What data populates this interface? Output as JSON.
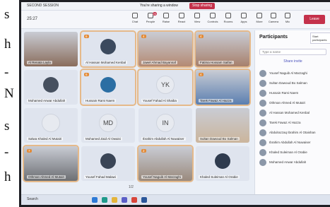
{
  "left_margin_text": [
    "s",
    "h",
    "-",
    "N",
    "s",
    "-",
    "h"
  ],
  "window": {
    "title": "SECOND SESSION",
    "sharing_text": "You're sharing a window",
    "stop_sharing_label": "Stop sharing",
    "timer": "25:27"
  },
  "toolbar": {
    "items": [
      {
        "label": "Chat",
        "icon": "chat-icon"
      },
      {
        "label": "People",
        "icon": "people-icon",
        "badge": "20"
      },
      {
        "label": "Raise",
        "icon": "raise-hand-icon"
      },
      {
        "label": "React",
        "icon": "react-icon"
      },
      {
        "label": "View",
        "icon": "view-icon"
      },
      {
        "label": "Controls",
        "icon": "controls-icon"
      },
      {
        "label": "Rooms",
        "icon": "rooms-icon"
      },
      {
        "label": "Apps",
        "icon": "apps-icon"
      },
      {
        "label": "More",
        "icon": "more-icon"
      },
      {
        "label": "Camera",
        "icon": "camera-icon"
      },
      {
        "label": "Mic",
        "icon": "mic-icon"
      },
      {
        "label": "Stop sharing",
        "icon": "share-icon"
      }
    ],
    "leave_label": "Leave"
  },
  "tiles": [
    {
      "name": "Al Renata Layla",
      "count": "",
      "kind": "photo",
      "highlight": false,
      "color": "#8a6d5c"
    },
    {
      "name": "Al Hassan Mohamed Kenbal",
      "count": "6",
      "kind": "avatar",
      "highlight": true,
      "color": "#3c4a5e"
    },
    {
      "name": "Jawel Ahmad Bayannaf",
      "count": "4",
      "kind": "photo",
      "highlight": true,
      "color": "#b48a73"
    },
    {
      "name": "Fatima Hossam Saifan",
      "count": "4",
      "kind": "photo",
      "highlight": true,
      "color": "#a7806c"
    },
    {
      "name": "Mohamed Anwar Abdullah",
      "count": "",
      "kind": "avatar",
      "highlight": false,
      "color": "#46505f"
    },
    {
      "name": "Hussain Rami Naem",
      "count": "6",
      "kind": "avatar",
      "highlight": true,
      "color": "#2b6ea3"
    },
    {
      "name": "Yousef Fahad Al Shaiba",
      "count": "",
      "kind": "initials",
      "initials": "YK",
      "highlight": true,
      "color": "#e7eaf0"
    },
    {
      "name": "Tarek Fawaz Al Hazza",
      "count": "4",
      "kind": "photo",
      "highlight": true,
      "color": "#5b7fb0"
    },
    {
      "name": "Salwa Khaled Al Mutairi",
      "count": "",
      "kind": "initials",
      "initials": "",
      "highlight": false,
      "color": "#e7eaf0"
    },
    {
      "name": "Mohamed Zaid Al Owaisi",
      "count": "",
      "kind": "initials",
      "initials": "MD",
      "highlight": false,
      "color": "#e7eaf0"
    },
    {
      "name": "Ibrahim Abdullah Al Nuwaiser",
      "count": "",
      "kind": "initials",
      "initials": "IN",
      "highlight": false,
      "color": "#e7eaf0"
    },
    {
      "name": "Sultan Dawoud Bo Salman",
      "count": "",
      "kind": "photo",
      "highlight": false,
      "color": "#cbb59c"
    },
    {
      "name": "Othman Ahmed Al Mutairi",
      "count": "7",
      "kind": "photo",
      "highlight": true,
      "color": "#6d6f73"
    },
    {
      "name": "Yousef Fahad Malawi",
      "count": "",
      "kind": "avatar",
      "highlight": false,
      "color": "#3a4556"
    },
    {
      "name": "Yousef Naguib Al Marzaghi",
      "count": "2",
      "kind": "photo",
      "highlight": true,
      "color": "#9a8a7d"
    },
    {
      "name": "Khaled Suleiman Al Orabie",
      "count": "",
      "kind": "avatar",
      "highlight": false,
      "color": "#2f3b4e"
    }
  ],
  "pager": "1/2",
  "panel": {
    "title": "Participants",
    "tooltip": "Start participants",
    "search_placeholder": "Type a name",
    "share_invite": "Share invite",
    "people": [
      "Yousef Naguib Al Marzaghi",
      "Sultan Dawoud Bo Salman",
      "Hussain Rami Naem",
      "Othman Ahmed Al Mutairi",
      "Al Hassan Mohamed Kenbal",
      "Tarek Fawaz Al Hazza",
      "Abdulrazzaq Ibrahim Al Otaishan",
      "Ibrahim Abdullah Al Nuwaiser",
      "Khaled Suleiman Al Orabie",
      "Mohamed Anwar Abdullah"
    ]
  },
  "taskbar": {
    "search_label": "Search"
  }
}
